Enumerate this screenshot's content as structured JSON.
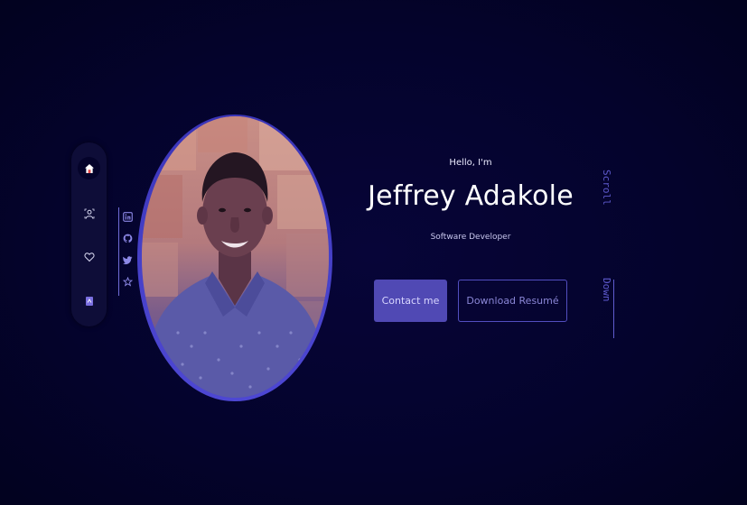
{
  "nav": {
    "items": [
      {
        "icon": "home-icon",
        "active": true
      },
      {
        "icon": "user-icon",
        "active": false
      },
      {
        "icon": "heart-icon",
        "active": false
      },
      {
        "icon": "document-icon",
        "active": false
      }
    ]
  },
  "social": {
    "links": [
      "linkedin-icon",
      "github-icon",
      "twitter-icon",
      "star-icon"
    ]
  },
  "hero": {
    "greeting": "Hello, I'm",
    "name": "Jeffrey Adakole",
    "role": "Software Developer",
    "contact_label": "Contact me",
    "download_label": "Download Resumé"
  },
  "scroll": {
    "word1": "Scroll",
    "word2": "Down"
  },
  "colors": {
    "background": "#03022a",
    "accent": "#5049b4",
    "nav_bg": "#0e0d38"
  }
}
